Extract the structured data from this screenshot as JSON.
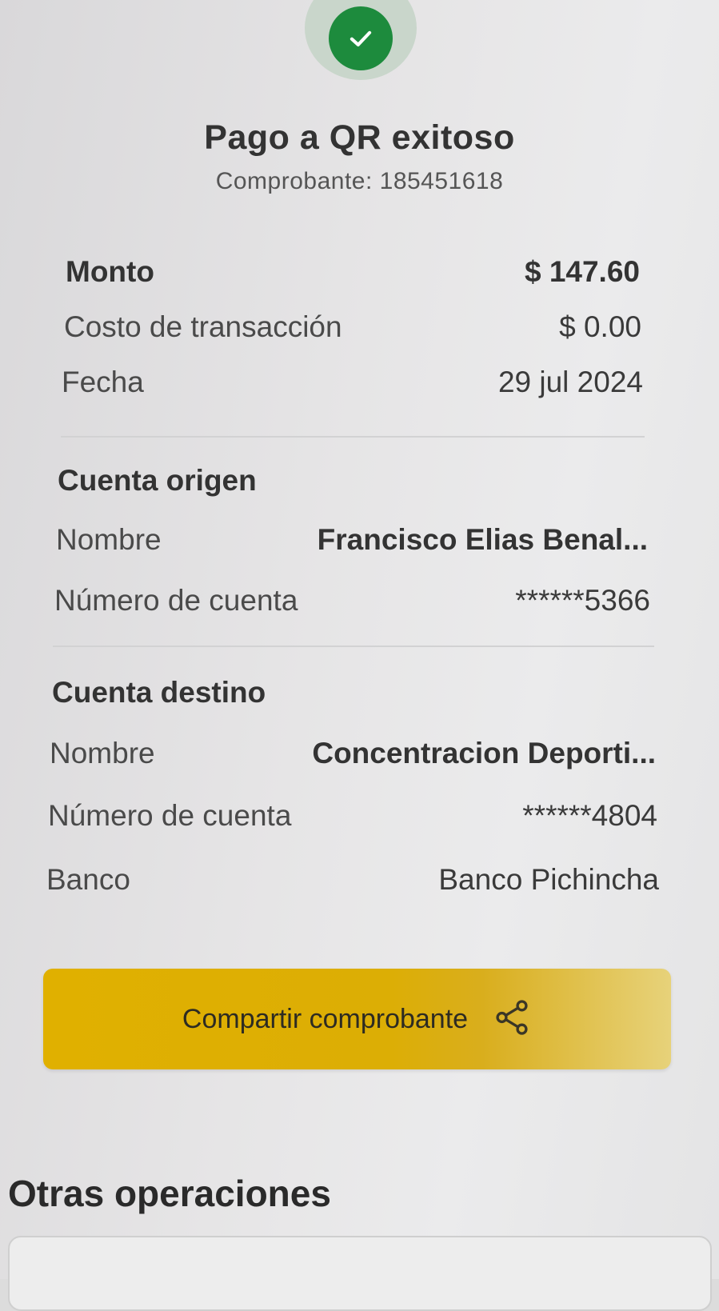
{
  "header": {
    "status_icon": "check-icon",
    "title": "Pago a QR exitoso",
    "receipt": "Comprobante: 185451618"
  },
  "summary": {
    "amount_label": "Monto",
    "amount_value": "$ 147.60",
    "fee_label": "Costo de transacción",
    "fee_value": "$ 0.00",
    "date_label": "Fecha",
    "date_value": "29 jul 2024"
  },
  "origin": {
    "title": "Cuenta origen",
    "name_label": "Nombre",
    "name_value": "Francisco Elias Benal...",
    "account_label": "Número de cuenta",
    "account_value": "******5366"
  },
  "destination": {
    "title": "Cuenta destino",
    "name_label": "Nombre",
    "name_value": "Concentracion Deporti...",
    "account_label": "Número de cuenta",
    "account_value": "******4804",
    "bank_label": "Banco",
    "bank_value": "Banco Pichincha"
  },
  "share_button": {
    "label": "Compartir comprobante",
    "icon": "share-icon"
  },
  "other_operations": {
    "title": "Otras operaciones"
  },
  "colors": {
    "success_green": "#1d8b3d",
    "button_yellow": "#e0b000"
  }
}
